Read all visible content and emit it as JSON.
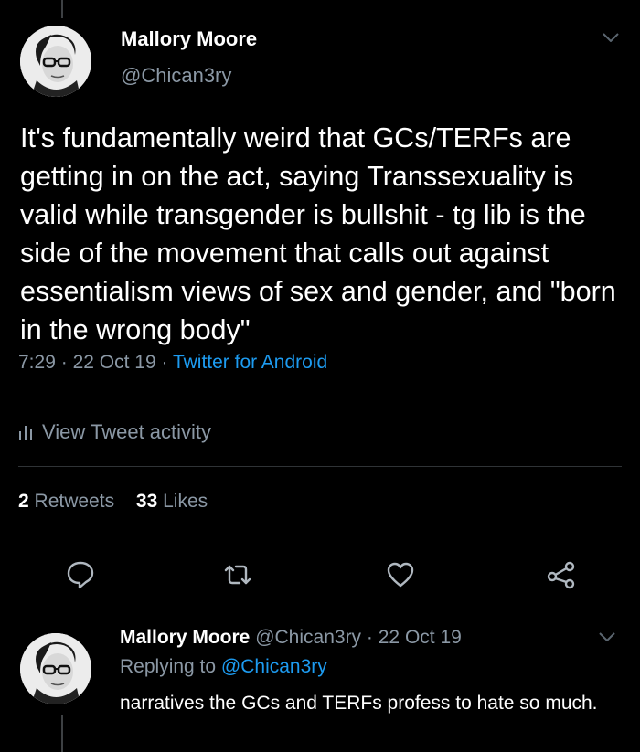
{
  "main_tweet": {
    "author_name": "Mallory Moore",
    "author_handle": "@Chican3ry",
    "text": "It's fundamentally weird that GCs/TERFs are getting in on the act, saying Transsexuality is valid while transgender is bullshit - tg lib is the side of the movement that calls out against essentialism views of sex and gender, and \"born in the wrong body\"",
    "time": "7:29",
    "date": "22 Oct 19",
    "separator": "·",
    "source": "Twitter for Android",
    "activity_label": "View Tweet activity",
    "retweets_count": "2",
    "retweets_label": "Retweets",
    "likes_count": "33",
    "likes_label": "Likes"
  },
  "actions": {
    "reply_icon": "speech-bubble-icon",
    "retweet_icon": "retweet-arrows-icon",
    "like_icon": "heart-icon",
    "share_icon": "share-nodes-icon"
  },
  "reply_tweet": {
    "author_name": "Mallory Moore",
    "author_handle": "@Chican3ry",
    "separator": "·",
    "date": "22 Oct 19",
    "replying_prefix": "Replying to",
    "replying_handle": "@Chican3ry",
    "text": "narratives the GCs and TERFs profess to hate so much."
  },
  "colors": {
    "background": "#000000",
    "text": "#ffffff",
    "muted": "#8b98a5",
    "link": "#1d9bf0",
    "divider": "#2f3336"
  }
}
